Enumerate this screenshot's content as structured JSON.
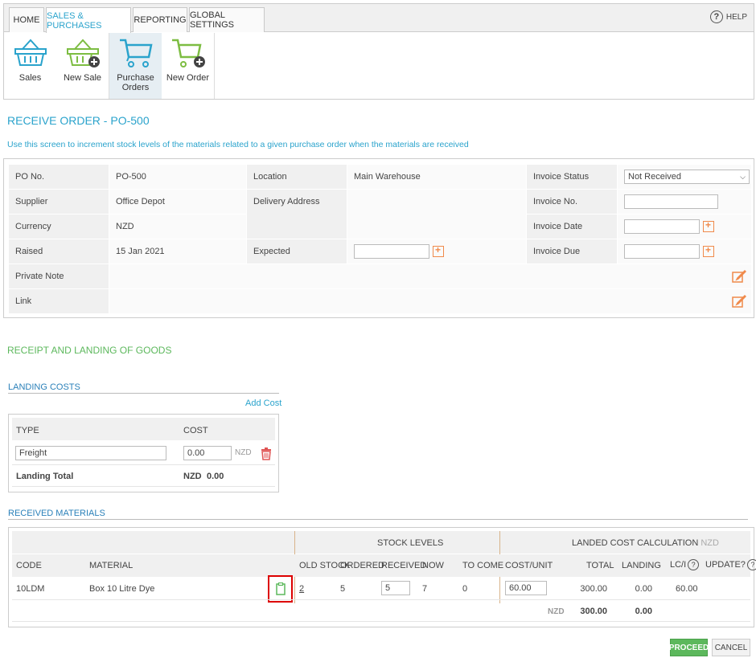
{
  "tabs": [
    {
      "label": "HOME"
    },
    {
      "label": "SALES & PURCHASES"
    },
    {
      "label": "REPORTING"
    },
    {
      "label": "GLOBAL SETTINGS"
    }
  ],
  "help_label": "HELP",
  "ribbon": [
    {
      "label": "Sales"
    },
    {
      "label": "New Sale"
    },
    {
      "label": "Purchase Orders"
    },
    {
      "label": "New Order"
    }
  ],
  "page_title": "RECEIVE ORDER - PO-500",
  "subtitle": "Use this screen to increment stock levels of the materials related to a given purchase order when the materials are received",
  "details": {
    "po_label": "PO No.",
    "po_value": "PO-500",
    "location_label": "Location",
    "location_value": "Main Warehouse",
    "invoice_status_label": "Invoice Status",
    "invoice_status_value": "Not Received",
    "supplier_label": "Supplier",
    "supplier_value": "Office Depot",
    "delivery_label": "Delivery Address",
    "invoice_no_label": "Invoice No.",
    "currency_label": "Currency",
    "currency_value": "NZD",
    "invoice_date_label": "Invoice Date",
    "raised_label": "Raised",
    "raised_value": "15 Jan 2021",
    "expected_label": "Expected",
    "invoice_due_label": "Invoice Due",
    "private_note_label": "Private Note",
    "link_label": "Link"
  },
  "receipt_title": "RECEIPT AND LANDING OF GOODS",
  "landing": {
    "title": "LANDING COSTS",
    "add_cost": "Add Cost",
    "col_type": "TYPE",
    "col_cost": "COST",
    "row_type": "Freight",
    "row_cost": "0.00",
    "row_currency": "NZD",
    "total_label": "Landing Total",
    "total_currency": "NZD",
    "total_value": "0.00"
  },
  "received": {
    "title": "RECEIVED MATERIALS",
    "group_stock": "STOCK LEVELS",
    "group_landed": "LANDED COST CALCULATION",
    "group_currency": "NZD",
    "headers": {
      "code": "CODE",
      "material": "MATERIAL",
      "old_stock": "OLD STOCK",
      "ordered": "ORDERED",
      "received": "RECEIVED",
      "now": "NOW",
      "to_come": "TO COME",
      "cost_unit": "COST/UNIT",
      "total": "TOTAL",
      "landing": "LANDING",
      "lci": "LC/I",
      "update": "UPDATE?"
    },
    "row": {
      "code": "10LDM",
      "material": "Box 10 Litre Dye",
      "old_stock": "2",
      "ordered": "5",
      "received": "5",
      "now": "7",
      "to_come": "0",
      "cost_unit": "60.00",
      "total": "300.00",
      "landing": "0.00",
      "lci": "60.00"
    },
    "footer": {
      "currency": "NZD",
      "total": "300.00",
      "landing": "0.00"
    }
  },
  "buttons": {
    "proceed": "PROCEED",
    "cancel": "CANCEL"
  },
  "colors": {
    "accent": "#2aa3cc",
    "green": "#5cb85c",
    "orange": "#f08a4b",
    "red": "#e05555"
  }
}
